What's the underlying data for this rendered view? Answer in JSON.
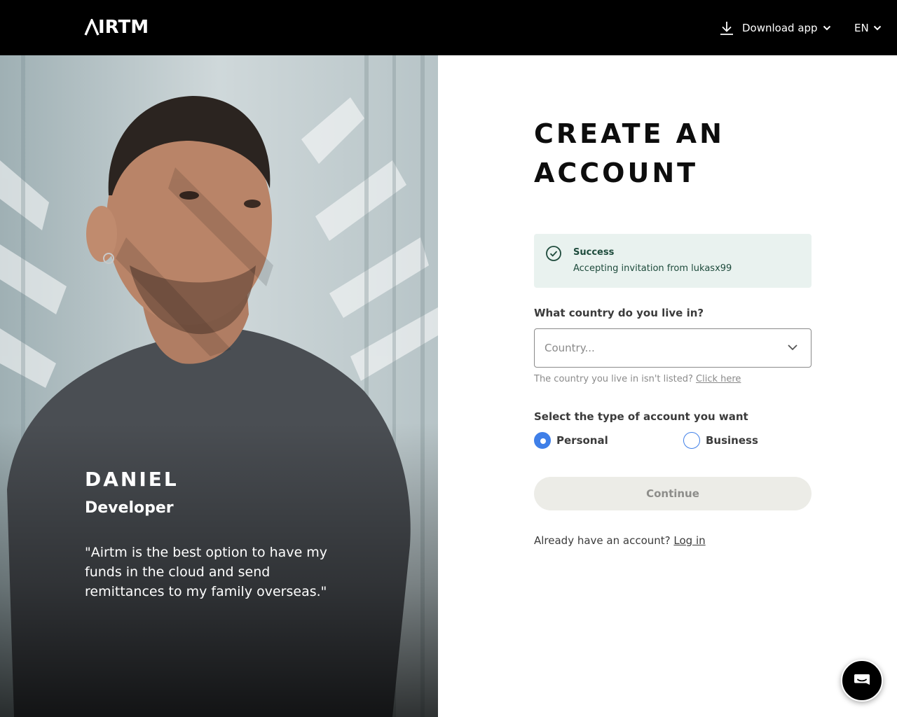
{
  "header": {
    "brand": "IRTM",
    "download_label": "Download app",
    "language": "EN"
  },
  "hero": {
    "name": "DANIEL",
    "role": "Developer",
    "quote": "\"Airtm is the best option to have my funds in the cloud and send remittances to my family overseas.\""
  },
  "form": {
    "title": "CREATE AN ACCOUNT",
    "alert": {
      "title": "Success",
      "message": "Accepting invitation from lukasx99"
    },
    "country_question": "What country do you live in?",
    "country_placeholder": "Country...",
    "country_hint": "The country you live in isn't listed?",
    "country_hint_link": "Click here",
    "type_question": "Select the type of account you want",
    "account_types": [
      {
        "label": "Personal",
        "selected": true
      },
      {
        "label": "Business",
        "selected": false
      }
    ],
    "continue_label": "Continue",
    "login_prompt": "Already have an account?",
    "login_link": "Log in"
  },
  "colors": {
    "header_bg": "#000000",
    "accent_blue": "#3f7fe8",
    "alert_bg": "#e9f2ef",
    "alert_text": "#1e4b3c",
    "button_disabled_bg": "#ecece7"
  },
  "icons": {
    "download": "download-icon",
    "chevron": "chevron-down-icon",
    "success": "check-circle-icon",
    "chat": "chat-icon"
  }
}
